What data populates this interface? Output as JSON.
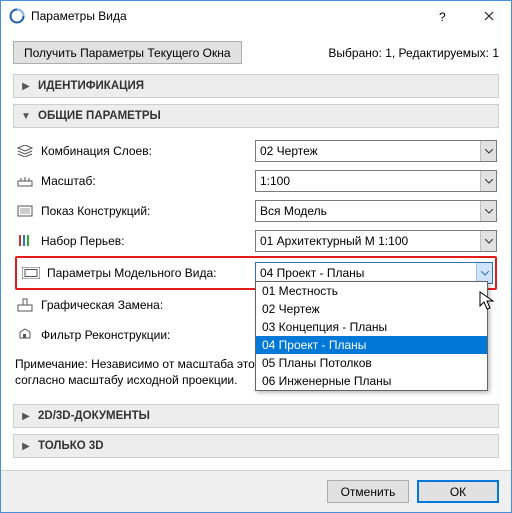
{
  "window": {
    "title": "Параметры Вида"
  },
  "toprow": {
    "get_current_btn": "Получить Параметры Текущего Окна",
    "status": "Выбрано: 1, Редактируемых: 1"
  },
  "sections": {
    "identification": "ИДЕНТИФИКАЦИЯ",
    "general": "ОБЩИЕ ПАРАМЕТРЫ",
    "docs2d3d": "2D/3D-ДОКУМЕНТЫ",
    "only3d": "ТОЛЬКО 3D"
  },
  "params": {
    "layer_combo": {
      "label": "Комбинация Слоев:",
      "value": "02 Чертеж"
    },
    "scale": {
      "label": "Масштаб:",
      "value": "1:100"
    },
    "construction": {
      "label": "Показ Конструкций:",
      "value": "Вся Модель"
    },
    "pens": {
      "label": "Набор Перьев:",
      "value": "01 Архитектурный М 1:100"
    },
    "model_view": {
      "label": "Параметры Модельного Вида:",
      "value": "04 Проект - Планы"
    },
    "graphic_override": {
      "label": "Графическая Замена:",
      "value": ""
    },
    "reno_filter": {
      "label": "Фильтр Реконструкции:",
      "value": ""
    }
  },
  "dropdown": {
    "options": [
      "01 Местность",
      "02 Чертеж",
      "03 Концепция - Планы",
      "04 Проект - Планы",
      "05 Планы Потолков",
      "06 Инженерные Планы"
    ],
    "selected_index": 3
  },
  "note": {
    "line1": "Примечание: Независимо от масштаба это",
    "line2": "согласно масштабу исходной проекции."
  },
  "footer": {
    "cancel": "Отменить",
    "ok": "ОК"
  }
}
